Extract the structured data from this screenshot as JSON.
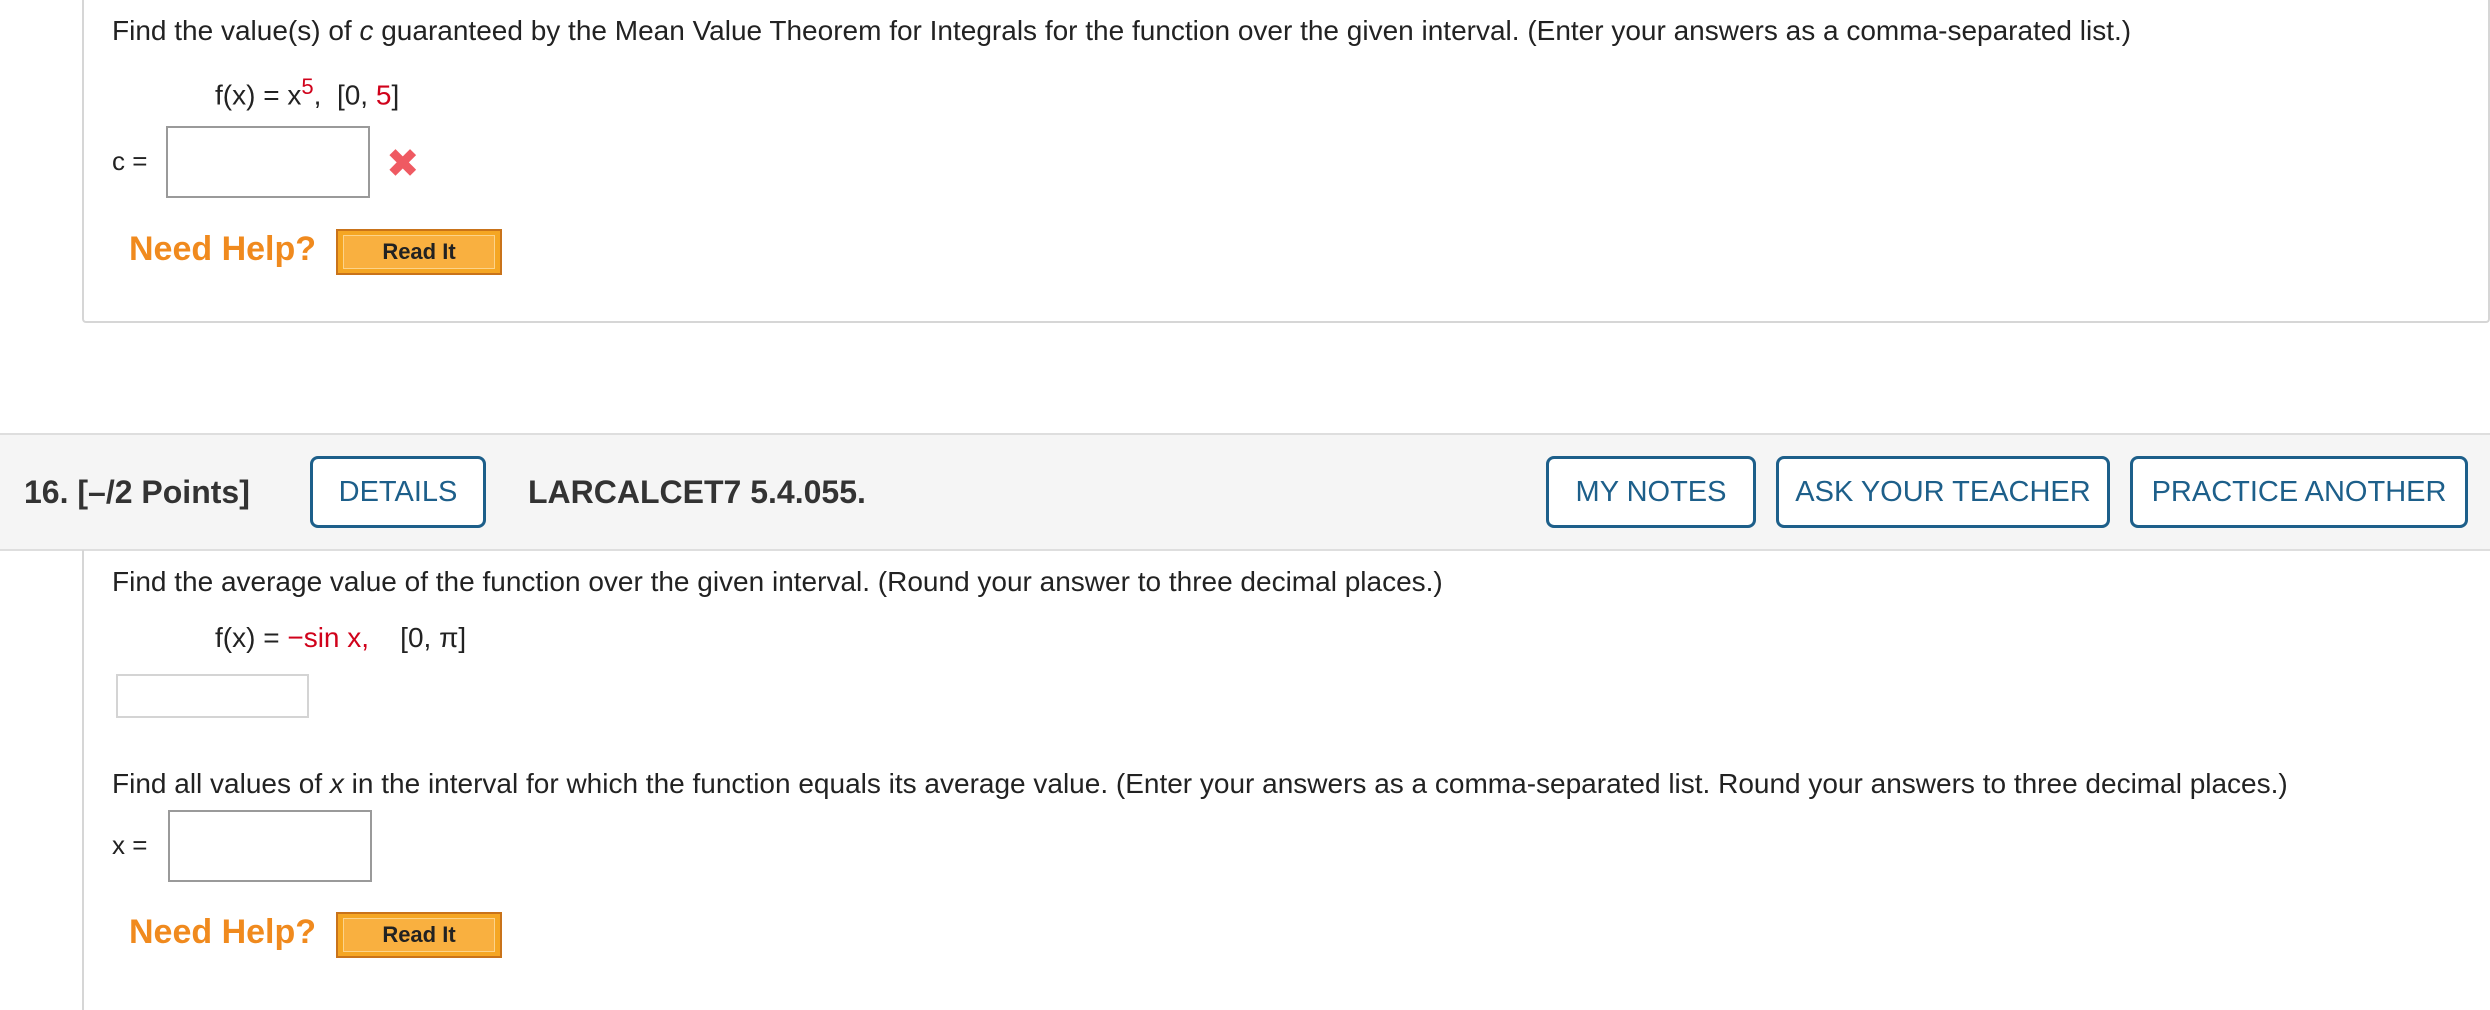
{
  "prev_question": {
    "prompt_pre": "Find the value(s) of ",
    "prompt_var": "c",
    "prompt_post": " guaranteed by the Mean Value Theorem for Integrals for the function over the given interval. (Enter your answers as a comma-separated list.)",
    "formula": {
      "lhs": "f(x) = x",
      "exponent": "5",
      "sep": ",",
      "interval_open": "[0, ",
      "interval_red": "5",
      "interval_close": "]"
    },
    "answer_label": "c =",
    "answer_value": "",
    "answer_status_icon": "x-mark-icon",
    "answer_status_glyph": "✖",
    "need_help": "Need Help?",
    "read_it": "Read It"
  },
  "question": {
    "number": "16.",
    "points": "[–/2 Points]",
    "details_button": "DETAILS",
    "id": "LARCALCET7 5.4.055.",
    "my_notes_button": "MY NOTES",
    "ask_teacher_button": "ASK YOUR TEACHER",
    "practice_button": "PRACTICE ANOTHER",
    "part1_prompt": "Find the average value of the function over the given interval. (Round your answer to three decimal places.)",
    "formula": {
      "lhs": "f(x) = ",
      "rhs_red": "−sin x,",
      "interval": "[0, π]"
    },
    "part1_answer": "",
    "part2_prompt_pre": "Find all values of ",
    "part2_prompt_var": "x",
    "part2_prompt_post": " in the interval for which the function equals its average value. (Enter your answers as a comma-separated list. Round your answers to three decimal places.)",
    "answer_label": "x =",
    "answer_value": "",
    "need_help": "Need Help?",
    "read_it": "Read It"
  },
  "colors": {
    "accent_blue": "#1d5f8a",
    "need_help_orange": "#f08a1e",
    "read_it_orange": "#f5a623",
    "formula_red": "#d0021b",
    "error_red": "#ef5a62"
  }
}
